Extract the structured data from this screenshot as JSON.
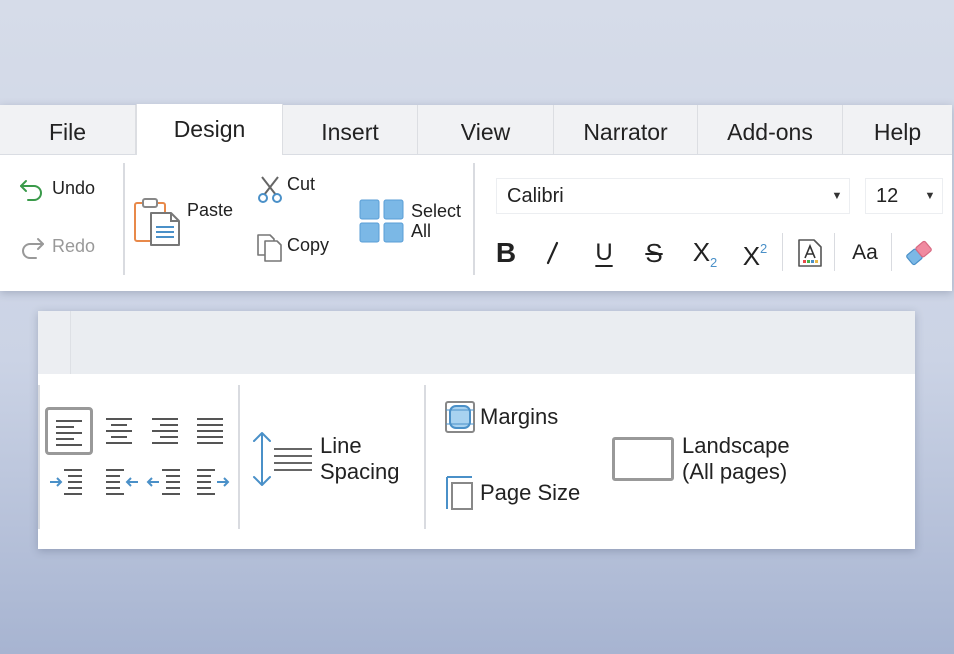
{
  "tabs": [
    "File",
    "Design",
    "Insert",
    "View",
    "Narrator",
    "Add-ons",
    "Help"
  ],
  "active_tab": "Design",
  "history": {
    "undo": "Undo",
    "redo": "Redo"
  },
  "clipboard": {
    "paste": "Paste",
    "cut": "Cut",
    "copy": "Copy",
    "select_all_line1": "Select",
    "select_all_line2": "All"
  },
  "font": {
    "family": "Calibri",
    "size": "12"
  },
  "format_icons": [
    "bold-icon",
    "italic-icon",
    "underline-icon",
    "strikethrough-icon",
    "subscript-icon",
    "superscript-icon",
    "text-color-icon",
    "change-case-icon",
    "clear-format-icon"
  ],
  "format_labels": {
    "bold": "B",
    "italic": "I",
    "underline": "U",
    "strike": "S",
    "sub": "X",
    "sub_digit": "2",
    "sup": "X",
    "sup_digit": "2",
    "case": "Aa"
  },
  "paragraph": {
    "align_icons": [
      "align-left-icon",
      "align-center-icon",
      "align-right-icon",
      "align-justify-icon"
    ],
    "indent_icons": [
      "indent-increase-icon",
      "outdent-left-icon",
      "outdent-right-icon",
      "indent-right-icon"
    ],
    "line_spacing_line1": "Line",
    "line_spacing_line2": "Spacing"
  },
  "page": {
    "margins": "Margins",
    "page_size": "Page Size",
    "orientation_line1": "Landscape",
    "orientation_line2": "(All pages)"
  },
  "colors": {
    "accent_blue": "#4a90c8",
    "tile_blue": "#7bb8e6",
    "paste_orange": "#e8894a",
    "undo_green": "#3a9a4a",
    "eraser_pink": "#f08aa0"
  }
}
